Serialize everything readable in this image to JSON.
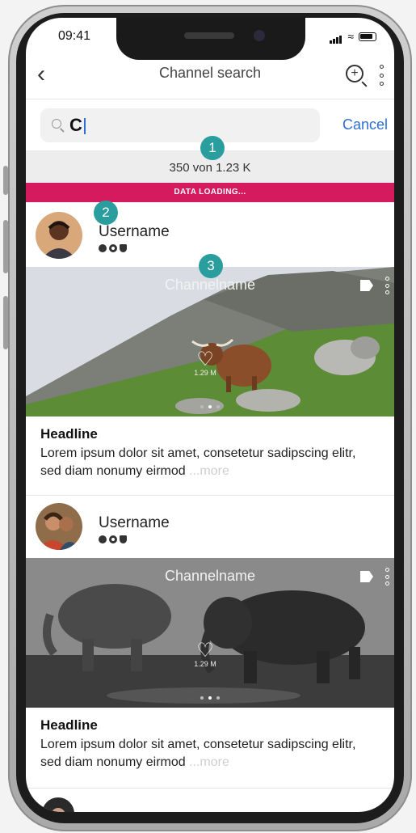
{
  "status": {
    "time": "09:41"
  },
  "nav": {
    "title": "Channel search"
  },
  "search": {
    "value": "C",
    "cancel_label": "Cancel"
  },
  "results": {
    "count_text": "350 von 1.23 K"
  },
  "loading": {
    "text": "DATA LOADING..."
  },
  "badges": [
    "1",
    "2",
    "3"
  ],
  "posts": [
    {
      "username": "Username",
      "channel": "Channelname",
      "likes": "1.29 M",
      "headline": "Headline",
      "body": "Lorem ipsum dolor sit amet, consetetur sadipscing elitr, sed diam nonumy eirmod",
      "more": "...more",
      "media_colors": {
        "sky": "#d9dde3",
        "grass": "#5d8c36",
        "animal": "#8a4f2a"
      }
    },
    {
      "username": "Username",
      "channel": "Channelname",
      "likes": "1.29 M",
      "headline": "Headline",
      "body": "Lorem ipsum dolor sit amet, consetetur sadipscing elitr, sed diam nonumy eirmod",
      "more": "...more",
      "media_colors": {
        "sky": "#8a8a8a",
        "ground": "#3c3c3c",
        "animal": "#2b2b2b"
      }
    }
  ],
  "colors": {
    "accent": "#2c6fd1",
    "loading": "#d51b5e",
    "badge": "#2a9d9e"
  }
}
